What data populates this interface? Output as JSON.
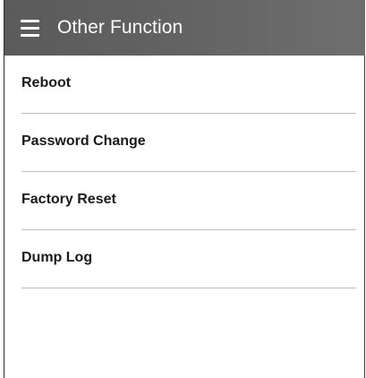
{
  "app_bar": {
    "title": "Other Function",
    "menu_icon": "hamburger-menu-icon"
  },
  "menu": {
    "items": [
      {
        "label": "Reboot"
      },
      {
        "label": "Password Change"
      },
      {
        "label": "Factory Reset"
      },
      {
        "label": "Dump Log"
      }
    ]
  },
  "colors": {
    "app_bar": "#616161",
    "app_bar_text": "#ffffff",
    "item_text": "#1a1a1a",
    "divider": "#bdbdbd",
    "background": "#ffffff"
  }
}
